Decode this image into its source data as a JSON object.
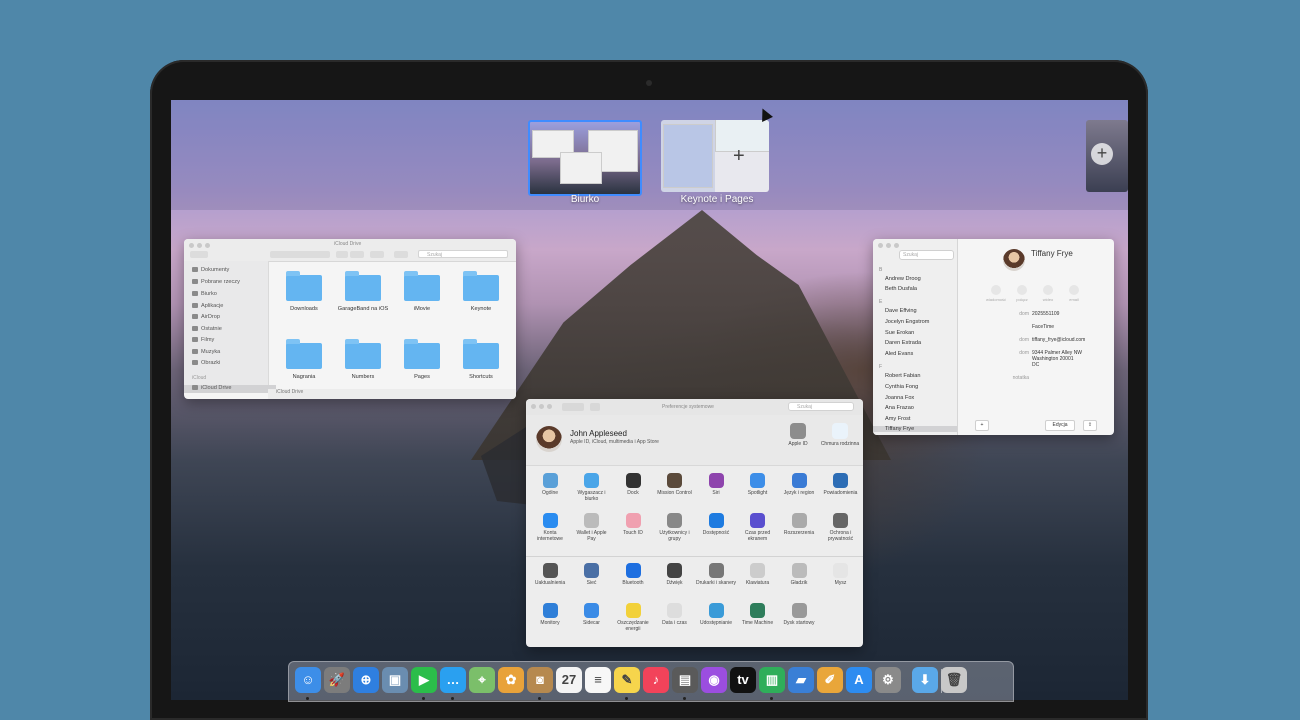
{
  "spaces": [
    {
      "label": "Biurko"
    },
    {
      "label": "Keynote i Pages"
    }
  ],
  "finder": {
    "title": "iCloud Drive",
    "search_placeholder": "Szukaj",
    "sidebar": [
      "Dokumenty",
      "Pobrane rzeczy",
      "Biurko",
      "Aplikacje",
      "AirDrop",
      "Ostatnie",
      "Filmy",
      "Muzyka",
      "Obrazki"
    ],
    "sidebar_section": "iCloud",
    "sidebar_selected": "iCloud Drive",
    "folders": [
      {
        "name": "Downloads",
        "icon": "download-icon"
      },
      {
        "name": "GarageBand na iOS",
        "icon": "garageband-icon"
      },
      {
        "name": "iMovie",
        "icon": "imovie-icon"
      },
      {
        "name": "Keynote",
        "icon": "keynote-icon"
      },
      {
        "name": "Nagrania",
        "icon": "recordings-icon"
      },
      {
        "name": "Numbers",
        "icon": "numbers-icon"
      },
      {
        "name": "Pages",
        "icon": "pages-icon"
      },
      {
        "name": "Shortcuts",
        "icon": "shortcuts-icon"
      }
    ],
    "status": "iCloud Drive"
  },
  "contacts": {
    "search_placeholder": "Szukaj",
    "groups": [
      {
        "letter": "B",
        "names": [
          "Andrew Droog",
          "Beth Dusfala"
        ]
      },
      {
        "letter": "E",
        "names": [
          "Dave Effving",
          "Jocelyn Engstrom",
          "Sue Erokan",
          "Daren Estrada",
          "Aled Evans"
        ]
      },
      {
        "letter": "F",
        "names": [
          "Robert Fabian",
          "Cynthia Fong",
          "Joanna Fox",
          "Ana Frazao",
          "Amy Frost",
          "Tiffany Frye"
        ]
      }
    ],
    "selected": "Tiffany Frye",
    "detail": {
      "name": "Tiffany Frye",
      "actions": [
        "wiadomość",
        "połącz",
        "wideo",
        "email"
      ],
      "fields": [
        {
          "label": "dom",
          "value": "2025551109"
        },
        {
          "label": "",
          "value": "FaceTime"
        },
        {
          "label": "dom",
          "value": "tiffany_frye@icloud.com"
        },
        {
          "label": "dom",
          "value": "9344 Palmer Alley NW\nWashington 20001\nDC"
        },
        {
          "label": "notatka",
          "value": ""
        }
      ],
      "add_label": "+",
      "edit_label": "Edycja",
      "share_label": "⇪"
    }
  },
  "prefs": {
    "title": "Preferencje systemowe",
    "search_placeholder": "Szukaj",
    "account_name": "John Appleseed",
    "account_sub": "Apple ID, iCloud, multimedia i App Store",
    "top_items": [
      {
        "label": "Apple ID",
        "icon": "apple-icon"
      },
      {
        "label": "Chmura rodzinna",
        "icon": "cloud-icon"
      }
    ],
    "rows": [
      [
        {
          "label": "Ogólne",
          "icon": "general-icon",
          "color": "#5aa0d8"
        },
        {
          "label": "Wygaszacz i biurko",
          "icon": "desktop-icon",
          "color": "#4aa5e8"
        },
        {
          "label": "Dock",
          "icon": "dock-icon",
          "color": "#333333"
        },
        {
          "label": "Mission Control",
          "icon": "mission-control-icon",
          "color": "#5b4a3b"
        },
        {
          "label": "Siri",
          "icon": "siri-icon",
          "color": "#8e44ad"
        },
        {
          "label": "Spotlight",
          "icon": "spotlight-icon",
          "color": "#3d8ee8"
        },
        {
          "label": "Język i region",
          "icon": "language-icon",
          "color": "#3a7bd5"
        },
        {
          "label": "Powiadomienia",
          "icon": "notifications-icon",
          "color": "#2d6db5"
        }
      ],
      [
        {
          "label": "Konta internetowe",
          "icon": "at-icon",
          "color": "#2a8cf0"
        },
        {
          "label": "Wallet i Apple Pay",
          "icon": "wallet-icon",
          "color": "#bbbbbb"
        },
        {
          "label": "Touch ID",
          "icon": "fingerprint-icon",
          "color": "#f0a0b0"
        },
        {
          "label": "Użytkownicy i grupy",
          "icon": "users-icon",
          "color": "#888888"
        },
        {
          "label": "Dostępność",
          "icon": "accessibility-icon",
          "color": "#1e7be0"
        },
        {
          "label": "Czas przed ekranem",
          "icon": "hourglass-icon",
          "color": "#5a4fcf"
        },
        {
          "label": "Rozszerzenia",
          "icon": "puzzle-icon",
          "color": "#aaaaaa"
        },
        {
          "label": "Ochrona i prywatność",
          "icon": "house-icon",
          "color": "#666666"
        }
      ],
      [
        {
          "label": "Uaktualnienia",
          "icon": "gear-icon",
          "color": "#555555"
        },
        {
          "label": "Sieć",
          "icon": "globe-icon",
          "color": "#4a6fa5"
        },
        {
          "label": "Bluetooth",
          "icon": "bluetooth-icon",
          "color": "#1e6fe0"
        },
        {
          "label": "Dźwięk",
          "icon": "speaker-icon",
          "color": "#444444"
        },
        {
          "label": "Drukarki i skanery",
          "icon": "printer-icon",
          "color": "#777777"
        },
        {
          "label": "Klawiatura",
          "icon": "keyboard-icon",
          "color": "#cccccc"
        },
        {
          "label": "Gładzik",
          "icon": "trackpad-icon",
          "color": "#bbbbbb"
        },
        {
          "label": "Mysz",
          "icon": "mouse-icon",
          "color": "#e5e5e5"
        }
      ],
      [
        {
          "label": "Monitory",
          "icon": "monitor-icon",
          "color": "#2f7fd8"
        },
        {
          "label": "Sidecar",
          "icon": "sidecar-icon",
          "color": "#3a8be6"
        },
        {
          "label": "Oszczędzanie energii",
          "icon": "bulb-icon",
          "color": "#f2d13a"
        },
        {
          "label": "Data i czas",
          "icon": "clock-icon",
          "color": "#dddddd"
        },
        {
          "label": "Udostępnianie",
          "icon": "sharing-icon",
          "color": "#3a9bd8"
        },
        {
          "label": "Time Machine",
          "icon": "time-machine-icon",
          "color": "#2e7d5b"
        },
        {
          "label": "Dysk startowy",
          "icon": "disk-icon",
          "color": "#999999"
        }
      ]
    ]
  },
  "dock": [
    {
      "name": "finder-icon",
      "glyph": "☺",
      "color": "#3d8ee8"
    },
    {
      "name": "launchpad-icon",
      "glyph": "🚀",
      "color": "#7c7c7c"
    },
    {
      "name": "safari-icon",
      "glyph": "⊕",
      "color": "#2f7fe0"
    },
    {
      "name": "preview-icon",
      "glyph": "▣",
      "color": "#6a8db0"
    },
    {
      "name": "facetime-icon",
      "glyph": "▶",
      "color": "#2bbd4a"
    },
    {
      "name": "messages-icon",
      "glyph": "…",
      "color": "#2aa0f0"
    },
    {
      "name": "maps-icon",
      "glyph": "⌖",
      "color": "#7bbf6a"
    },
    {
      "name": "photos-icon",
      "glyph": "✿",
      "color": "#e8a23a"
    },
    {
      "name": "contacts-icon",
      "glyph": "◙",
      "color": "#b6894f"
    },
    {
      "name": "calendar-icon",
      "glyph": "27",
      "color": "#f4f4f4"
    },
    {
      "name": "reminders-icon",
      "glyph": "≡",
      "color": "#f7f7f7"
    },
    {
      "name": "notes-icon",
      "glyph": "✎",
      "color": "#f6d54c"
    },
    {
      "name": "music-icon",
      "glyph": "♪",
      "color": "#f2435a"
    },
    {
      "name": "books-icon",
      "glyph": "▤",
      "color": "#5a5a5a"
    },
    {
      "name": "podcasts-icon",
      "glyph": "◉",
      "color": "#9b4ee0"
    },
    {
      "name": "apple-tv-icon",
      "glyph": "tv",
      "color": "#111111"
    },
    {
      "name": "numbers-icon",
      "glyph": "▥",
      "color": "#2fae5a"
    },
    {
      "name": "keynote-icon",
      "glyph": "▰",
      "color": "#3a7fd6"
    },
    {
      "name": "pages-icon",
      "glyph": "✐",
      "color": "#e9a63a"
    },
    {
      "name": "app-store-icon",
      "glyph": "A",
      "color": "#2d8cf0"
    },
    {
      "name": "system-preferences-icon",
      "glyph": "⚙",
      "color": "#8a8a8a"
    },
    {
      "name": "downloads-folder-icon",
      "glyph": "⬇",
      "color": "#5aa8e8"
    },
    {
      "name": "trash-icon",
      "glyph": "🗑",
      "color": "#c8c8c8"
    }
  ]
}
